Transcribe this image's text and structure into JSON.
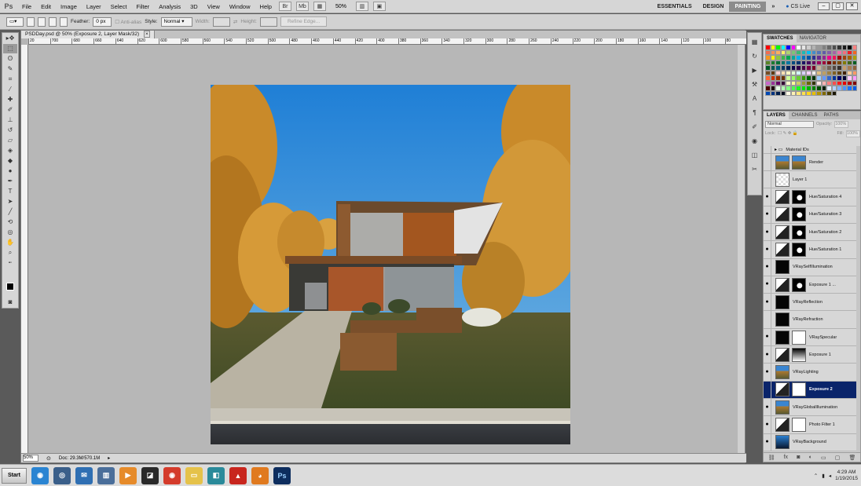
{
  "app": {
    "logo": "Ps",
    "menu": [
      "File",
      "Edit",
      "Image",
      "Layer",
      "Select",
      "Filter",
      "Analysis",
      "3D",
      "View",
      "Window",
      "Help"
    ],
    "zoom": "50%",
    "workspaces": [
      {
        "label": "ESSENTIALS",
        "active": false
      },
      {
        "label": "DESIGN",
        "active": false
      },
      {
        "label": "PAINTING",
        "active": true
      }
    ],
    "more": "»",
    "cs_live": "CS Live"
  },
  "options": {
    "feather_label": "Feather:",
    "feather_value": "0 px",
    "antialias": "Anti-alias",
    "style_label": "Style:",
    "style_value": "Normal",
    "width_label": "Width:",
    "height_label": "Height:",
    "refine": "Refine Edge..."
  },
  "document": {
    "tab_title": "PSDDay.psd @ 50% (Exposure 2, Layer Mask/32)",
    "close": "×",
    "ruler_ticks": [
      "20",
      "700",
      "680",
      "660",
      "640",
      "620",
      "600",
      "580",
      "560",
      "540",
      "520",
      "500",
      "480",
      "460",
      "440",
      "420",
      "400",
      "380",
      "360",
      "340",
      "320",
      "300",
      "280",
      "260",
      "240",
      "220",
      "200",
      "180",
      "160",
      "140",
      "120",
      "100",
      "80"
    ],
    "status_zoom": "50%",
    "status_doc": "Doc: 29.3M/570.1M"
  },
  "swatches": {
    "tabs": [
      "SWATCHES",
      "NAVIGATOR"
    ],
    "colors": [
      "#ff0000",
      "#ffff00",
      "#00ff00",
      "#00ffff",
      "#0000ff",
      "#ff00ff",
      "#ffffff",
      "#e6e6e6",
      "#cccccc",
      "#b3b3b3",
      "#999999",
      "#808080",
      "#666666",
      "#4d4d4d",
      "#333333",
      "#1a1a1a",
      "#000000",
      "#ff8080",
      "#f26c4f",
      "#f68e56",
      "#fbaf5d",
      "#fff467",
      "#acd372",
      "#7cc576",
      "#3bb878",
      "#1abbb4",
      "#00bff3",
      "#438ccb",
      "#5574b9",
      "#605ca8",
      "#855fa8",
      "#a763a8",
      "#f06ea9",
      "#f26d7d",
      "#ed1c24",
      "#f26522",
      "#f7941d",
      "#fff200",
      "#8dc63f",
      "#39b54a",
      "#00a651",
      "#00a99d",
      "#00aeef",
      "#0072bc",
      "#0054a6",
      "#2e3192",
      "#662d91",
      "#92278f",
      "#ec008c",
      "#ed145b",
      "#9e0b0f",
      "#a0410d",
      "#a36209",
      "#aba000",
      "#598527",
      "#1a7b30",
      "#007236",
      "#00746b",
      "#0076a3",
      "#004b80",
      "#003471",
      "#1b1464",
      "#440e62",
      "#630460",
      "#9e005d",
      "#9e0039",
      "#790000",
      "#7b2e00",
      "#7d4900",
      "#827b00",
      "#406618",
      "#005e20",
      "#005826",
      "#005952",
      "#005b7f",
      "#003663",
      "#002157",
      "#0d004c",
      "#32004b",
      "#4b0049",
      "#7b0046",
      "#7a0026",
      "#c7b299",
      "#998675",
      "#736357",
      "#534741",
      "#37302d",
      "#c69c6d",
      "#a67c52",
      "#8c6239",
      "#754c24",
      "#603913",
      "#ffd1d1",
      "#ffe0b2",
      "#fff5c2",
      "#e0ffd1",
      "#d1f4ff",
      "#d9d1ff",
      "#f7d1ff",
      "#f0f0f0",
      "#e0c080",
      "#c0a060",
      "#a08040",
      "#806020",
      "#604010",
      "#402000",
      "#ffcc99",
      "#ff9966",
      "#ff6633",
      "#cc3300",
      "#993300",
      "#663300",
      "#ccff99",
      "#99ff66",
      "#66cc33",
      "#339900",
      "#006600",
      "#003300",
      "#99ccff",
      "#6699ff",
      "#3366cc",
      "#003399",
      "#000066",
      "#000033",
      "#ffccff",
      "#ff99ff",
      "#cc66cc",
      "#993399",
      "#660066",
      "#330033",
      "#ffffcc",
      "#ffff99",
      "#cccc66",
      "#999933",
      "#666600",
      "#333300",
      "#ffe6e6",
      "#ffb3b3",
      "#ff8080",
      "#ff4d4d",
      "#ff1a1a",
      "#e60000",
      "#b30000",
      "#800000",
      "#4d0000",
      "#1a0000",
      "#e6ffe6",
      "#b3ffb3",
      "#80ff80",
      "#4dff4d",
      "#1aff1a",
      "#00e600",
      "#00b300",
      "#008000",
      "#004d00",
      "#001a00",
      "#e6f0ff",
      "#b3d1ff",
      "#80b3ff",
      "#4d94ff",
      "#1a75ff",
      "#005ce6",
      "#0047b3",
      "#003380",
      "#001f4d",
      "#000a1a",
      "#fffbe6",
      "#fff2b3",
      "#ffe980",
      "#ffe04d",
      "#ffd71a",
      "#e6bf00",
      "#b39500",
      "#806a00",
      "#4d4000",
      "#1a1500"
    ]
  },
  "layers": {
    "tabs": [
      "LAYERS",
      "CHANNELS",
      "PATHS"
    ],
    "blend_mode": "Normal",
    "opacity_label": "Opacity:",
    "opacity_value": "100%",
    "lock_label": "Lock:",
    "fill_label": "Fill:",
    "fill_value": "100%",
    "items": [
      {
        "name": "Material IDs",
        "type": "folder",
        "visible": false
      },
      {
        "name": "Render",
        "thumb": "render",
        "mask": "render",
        "visible": false
      },
      {
        "name": "Layer 1",
        "thumb": "checker",
        "visible": false
      },
      {
        "name": "Hue/Saturation 4",
        "thumb": "adj",
        "mask": "dark",
        "visible": true
      },
      {
        "name": "Hue/Saturation 3",
        "thumb": "adj",
        "mask": "dark",
        "visible": true
      },
      {
        "name": "Hue/Saturation 2",
        "thumb": "adj",
        "mask": "dark",
        "visible": true
      },
      {
        "name": "Hue/Saturation 1",
        "thumb": "adj",
        "mask": "dark",
        "visible": true
      },
      {
        "name": "VRaySelfIllumination",
        "thumb": "black",
        "visible": true
      },
      {
        "name": "Exposure 1 ...",
        "thumb": "adj",
        "mask": "dark",
        "visible": true
      },
      {
        "name": "VRayReflection",
        "thumb": "black",
        "visible": true
      },
      {
        "name": "VRayRefraction",
        "thumb": "black",
        "visible": false
      },
      {
        "name": "VRaySpecular",
        "thumb": "black",
        "mask": "white",
        "visible": true
      },
      {
        "name": "Exposure 1",
        "thumb": "adj",
        "mask": "grad",
        "visible": true
      },
      {
        "name": "VRayLighting",
        "thumb": "render",
        "visible": true
      },
      {
        "name": "Exposure 2",
        "thumb": "adj",
        "mask": "white",
        "visible": false,
        "selected": true
      },
      {
        "name": "VRayGlobalIllumination",
        "thumb": "render",
        "visible": true
      },
      {
        "name": "Photo Filter 1",
        "thumb": "adj",
        "mask": "white",
        "visible": true
      },
      {
        "name": "VRayBackground",
        "thumb": "sky",
        "visible": true
      }
    ]
  },
  "taskbar": {
    "start": "Start",
    "time": "4:29 AM",
    "date": "1/19/2015"
  }
}
